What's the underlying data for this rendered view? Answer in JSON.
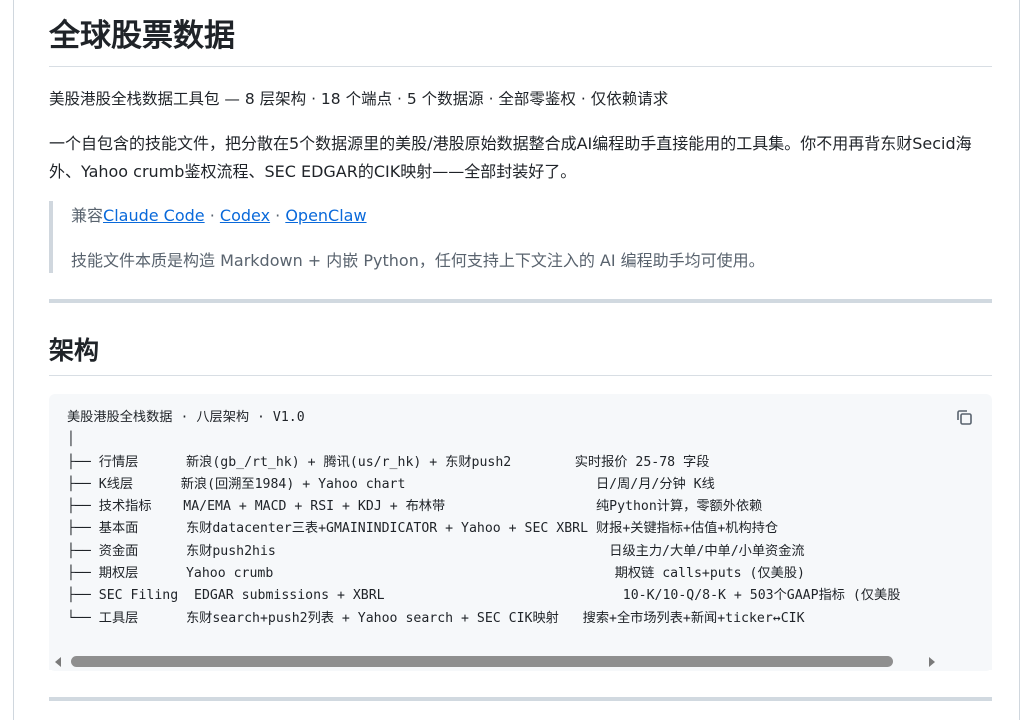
{
  "page": {
    "title": "全球股票数据",
    "tagline": "美股港股全栈数据工具包 — 8 层架构 · 18 个端点 · 5 个数据源 · 全部零鉴权 · 仅依赖请求",
    "intro": "一个自包含的技能文件，把分散在5个数据源里的美股/港股原始数据整合成AI编程助手直接能用的工具集。你不用再背东财Secid海外、Yahoo crumb鉴权流程、SEC EDGAR的CIK映射——全部封装好了。"
  },
  "compat": {
    "prefix": "兼容",
    "links": [
      "Claude Code",
      "Codex",
      "OpenClaw"
    ],
    "separator": " · ",
    "note": "技能文件本质是构造 Markdown + 内嵌 Python，任何支持上下文注入的 AI 编程助手均可使用。"
  },
  "architecture": {
    "heading": "架构",
    "code_lines": [
      "美股港股全栈数据 · 八层架构 · V1.0",
      "│",
      "├── 行情层      新浪(gb_/rt_hk) + 腾讯(us/r_hk) + 东财push2        实时报价 25-78 字段",
      "├── K线层      新浪(回溯至1984) + Yahoo chart                        日/周/月/分钟 K线",
      "├── 技术指标    MA/EMA + MACD + RSI + KDJ + 布林带                   纯Python计算，零额外依赖",
      "├── 基本面      东财datacenter三表+GMAININDICATOR + Yahoo + SEC XBRL 财报+关键指标+估值+机构持仓",
      "├── 资金面      东财push2his                                          日级主力/大单/中单/小单资金流",
      "├── 期权层      Yahoo crumb                                           期权链 calls+puts (仅美股)",
      "├── SEC Filing  EDGAR submissions + XBRL                              10-K/10-Q/8-K + 503个GAAP指标 (仅美股",
      "└── 工具层      东财search+push2列表 + Yahoo search + SEC CIK映射   搜索+全市场列表+新闻+ticker↔CIK"
    ]
  },
  "icons": {
    "copy": "copy-icon",
    "scroll_left": "scroll-left-arrow-icon",
    "scroll_right": "scroll-right-arrow-icon"
  },
  "colors": {
    "link": "#0969da",
    "text": "#1f2328",
    "muted": "#59636e",
    "code_bg": "#f6f8fa"
  }
}
